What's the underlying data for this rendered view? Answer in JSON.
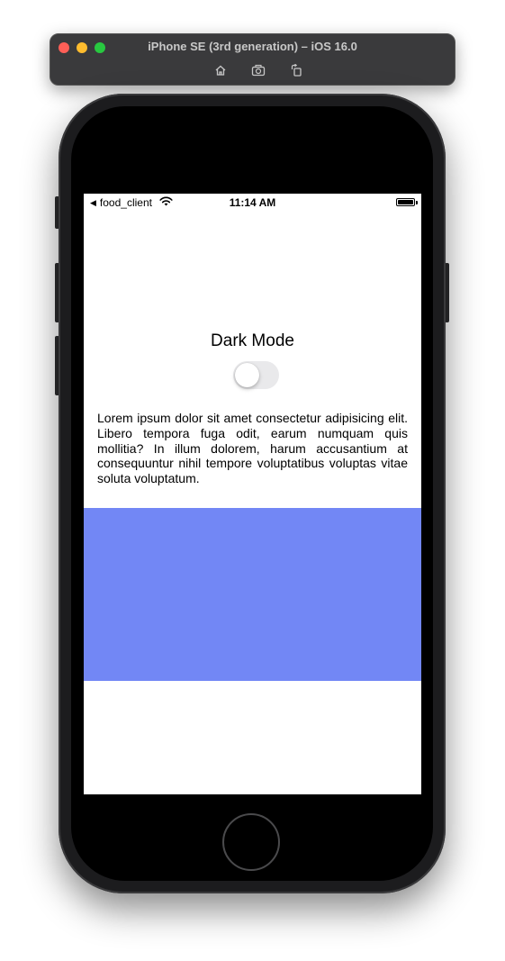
{
  "simulator": {
    "title": "iPhone SE (3rd generation) – iOS 16.0",
    "tools": [
      {
        "icon": "home-icon"
      },
      {
        "icon": "screenshot-icon"
      },
      {
        "icon": "rotate-icon"
      }
    ]
  },
  "status_bar": {
    "back_app": "food_client",
    "back_arrow": "◀",
    "time": "11:14 AM",
    "wifi_icon": "wifi-icon",
    "battery_icon": "battery-icon"
  },
  "screen": {
    "dark_mode_label": "Dark Mode",
    "dark_mode_enabled": false,
    "body_text": "Lorem ipsum dolor sit amet consectetur adipisicing elit. Libero tempora fuga odit, earum numquam quis mollitia? In illum dolorem, harum accusantium at consequuntur nihil tempore voluptatibus voluptas vitae soluta voluptatum.",
    "box_color": "#7287f5"
  }
}
